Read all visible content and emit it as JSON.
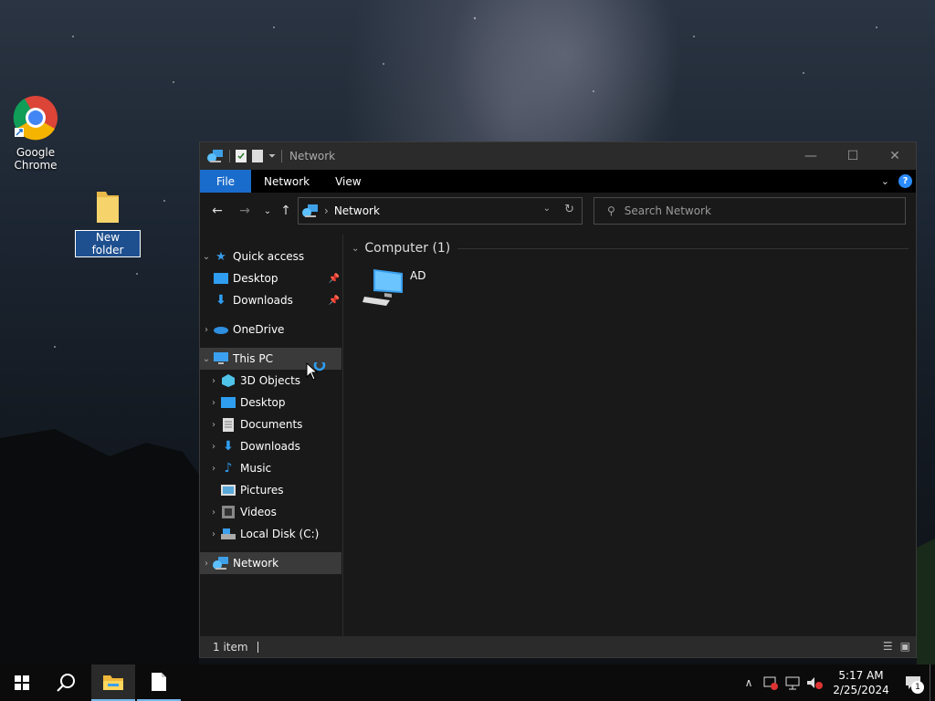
{
  "desktop": {
    "icons": [
      {
        "label": "Google Chrome"
      },
      {
        "label": "New folder"
      }
    ]
  },
  "window": {
    "title": "Network",
    "ribbon_tabs": [
      "File",
      "Network",
      "View"
    ],
    "help_label": "?",
    "address": {
      "path": "Network"
    },
    "search": {
      "placeholder": "Search Network"
    },
    "nav": {
      "quick_access": "Quick access",
      "qa_items": [
        "Desktop",
        "Downloads"
      ],
      "onedrive": "OneDrive",
      "this_pc": "This PC",
      "pc_items": [
        "3D Objects",
        "Desktop",
        "Documents",
        "Downloads",
        "Music",
        "Pictures",
        "Videos",
        "Local Disk (C:)"
      ],
      "network": "Network"
    },
    "content": {
      "group_title": "Computer (1)",
      "items": [
        {
          "label": "AD"
        }
      ]
    },
    "status": {
      "count": "1 item"
    }
  },
  "taskbar": {
    "time": "5:17 AM",
    "date": "2/25/2024",
    "notifications": "1"
  },
  "colors": {
    "accent": "#1a6ccc",
    "selection": "#3a3a3a",
    "window_bg": "#191919"
  }
}
